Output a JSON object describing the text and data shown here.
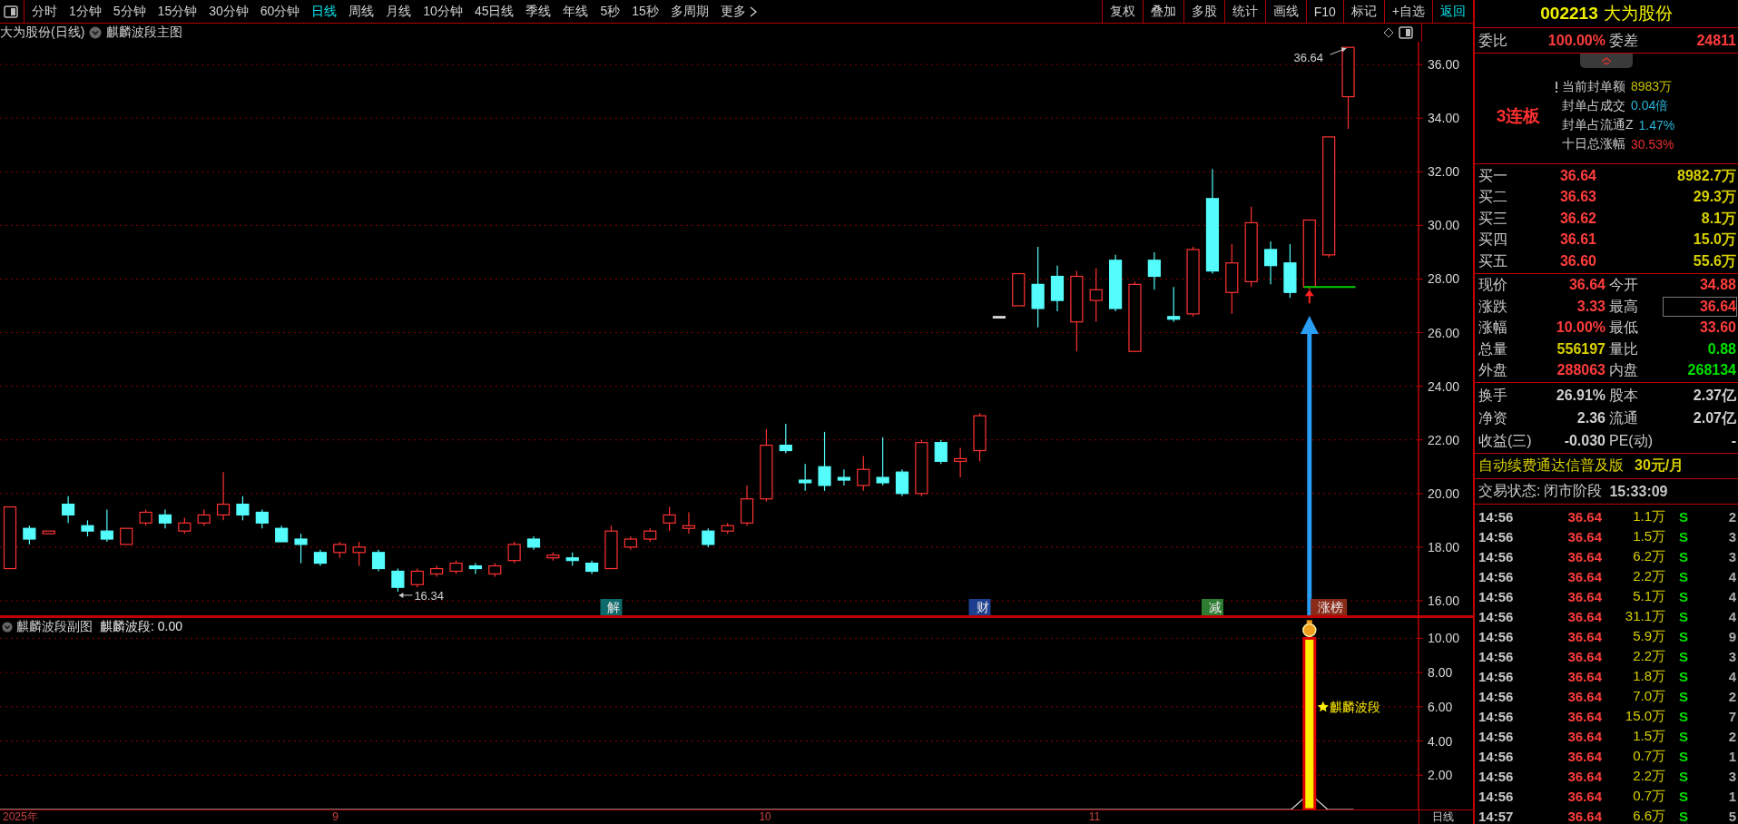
{
  "toolbar": {
    "periods": [
      {
        "label": "分时",
        "selected": false
      },
      {
        "label": "1分钟",
        "selected": false
      },
      {
        "label": "5分钟",
        "selected": false
      },
      {
        "label": "15分钟",
        "selected": false
      },
      {
        "label": "30分钟",
        "selected": false
      },
      {
        "label": "60分钟",
        "selected": false
      },
      {
        "label": "日线",
        "selected": true
      },
      {
        "label": "周线",
        "selected": false
      },
      {
        "label": "月线",
        "selected": false
      },
      {
        "label": "10分钟",
        "selected": false
      },
      {
        "label": "45日线",
        "selected": false
      },
      {
        "label": "季线",
        "selected": false
      },
      {
        "label": "年线",
        "selected": false
      },
      {
        "label": "5秒",
        "selected": false
      },
      {
        "label": "15秒",
        "selected": false
      },
      {
        "label": "多周期",
        "selected": false
      }
    ],
    "more": "更多",
    "buttons": [
      {
        "label": "复权",
        "active": false
      },
      {
        "label": "叠加",
        "active": false
      },
      {
        "label": "多股",
        "active": false
      },
      {
        "label": "统计",
        "active": false
      },
      {
        "label": "画线",
        "active": false
      },
      {
        "label": "F10",
        "active": false
      },
      {
        "label": "标记",
        "active": false
      },
      {
        "label": "+自选",
        "active": false
      },
      {
        "label": "返回",
        "active": true
      }
    ]
  },
  "main_chart": {
    "title": "大为股份(日线)",
    "indicator": "麒麟波段主图",
    "events": [
      {
        "label": "解",
        "color": "#0e6b6b"
      },
      {
        "label": "财",
        "color": "#1d3f8f"
      },
      {
        "label": "减",
        "color": "#2e7d32"
      },
      {
        "label": "涨榜",
        "color": "#8a2a18"
      }
    ],
    "chart_data": {
      "type": "candlestick",
      "grid": true,
      "ylim": [
        15.39,
        36.85
      ],
      "yticks": [
        {
          "value": 16,
          "label": "16.00"
        },
        {
          "value": 18,
          "label": "18.00"
        },
        {
          "value": 20,
          "label": "20.00"
        },
        {
          "value": 22,
          "label": "22.00"
        },
        {
          "value": 24,
          "label": "24.00"
        },
        {
          "value": 26,
          "label": "26.00"
        },
        {
          "value": 28,
          "label": "28.00"
        },
        {
          "value": 30,
          "label": "30.00"
        },
        {
          "value": 32,
          "label": "32.00"
        },
        {
          "value": 34,
          "label": "34.00"
        },
        {
          "value": 36,
          "label": "36.00"
        }
      ],
      "categories": [
        null,
        null,
        null,
        null,
        null,
        null,
        null,
        null,
        null,
        null,
        null,
        null,
        null,
        null,
        null,
        null,
        null,
        null,
        null,
        null,
        null,
        null,
        null,
        null,
        null,
        null,
        null,
        null,
        null,
        null,
        null,
        null,
        null,
        null,
        null,
        null,
        null,
        null,
        null,
        null,
        null,
        null,
        null,
        null,
        null,
        null,
        null,
        null,
        null,
        null,
        null,
        null,
        null,
        null,
        null,
        null,
        null,
        null,
        null,
        null,
        null,
        null,
        null,
        null,
        null,
        null,
        null,
        null,
        null,
        null
      ],
      "ohlc": [
        [
          17.2,
          19.5,
          17.2,
          19.5
        ],
        [
          18.7,
          18.8,
          18.1,
          18.3
        ],
        [
          18.5,
          18.6,
          18.5,
          18.6
        ],
        [
          19.6,
          19.9,
          18.9,
          19.2
        ],
        [
          18.8,
          19.0,
          18.4,
          18.6
        ],
        [
          18.6,
          19.4,
          18.2,
          18.3
        ],
        [
          18.1,
          18.7,
          18.1,
          18.7
        ],
        [
          18.9,
          19.4,
          18.8,
          19.3
        ],
        [
          19.2,
          19.4,
          18.7,
          18.9
        ],
        [
          18.6,
          19.1,
          18.5,
          18.9
        ],
        [
          18.9,
          19.4,
          18.8,
          19.2
        ],
        [
          19.2,
          20.8,
          19.0,
          19.6
        ],
        [
          19.6,
          19.9,
          19.0,
          19.2
        ],
        [
          19.3,
          19.4,
          18.7,
          18.9
        ],
        [
          18.7,
          18.8,
          18.2,
          18.2
        ],
        [
          18.3,
          18.5,
          17.4,
          18.1
        ],
        [
          17.8,
          17.9,
          17.3,
          17.4
        ],
        [
          17.8,
          18.2,
          17.6,
          18.1
        ],
        [
          17.8,
          18.2,
          17.3,
          18.0
        ],
        [
          17.8,
          17.9,
          17.1,
          17.2
        ],
        [
          17.1,
          17.2,
          16.34,
          16.5
        ],
        [
          16.6,
          17.2,
          16.5,
          17.1
        ],
        [
          17.0,
          17.3,
          16.9,
          17.2
        ],
        [
          17.1,
          17.5,
          17.0,
          17.4
        ],
        [
          17.3,
          17.4,
          17.0,
          17.2
        ],
        [
          17.0,
          17.4,
          16.9,
          17.3
        ],
        [
          17.5,
          18.2,
          17.4,
          18.1
        ],
        [
          18.3,
          18.4,
          17.9,
          18.0
        ],
        [
          17.6,
          17.8,
          17.5,
          17.7
        ],
        [
          17.6,
          17.8,
          17.3,
          17.5
        ],
        [
          17.4,
          17.5,
          17.0,
          17.1
        ],
        [
          17.2,
          18.8,
          17.2,
          18.6
        ],
        [
          18.0,
          18.4,
          17.9,
          18.3
        ],
        [
          18.3,
          18.7,
          18.2,
          18.6
        ],
        [
          18.9,
          19.5,
          18.6,
          19.2
        ],
        [
          18.7,
          19.3,
          18.5,
          18.8
        ],
        [
          18.6,
          18.7,
          18.0,
          18.1
        ],
        [
          18.6,
          18.9,
          18.5,
          18.8
        ],
        [
          18.9,
          20.3,
          18.8,
          19.8
        ],
        [
          19.8,
          22.4,
          19.7,
          21.8
        ],
        [
          21.8,
          22.6,
          21.5,
          21.6
        ],
        [
          20.5,
          21.1,
          20.1,
          20.4
        ],
        [
          21.0,
          22.3,
          20.1,
          20.3
        ],
        [
          20.6,
          20.9,
          20.3,
          20.5
        ],
        [
          20.3,
          21.4,
          20.1,
          20.9
        ],
        [
          20.6,
          22.1,
          20.3,
          20.4
        ],
        [
          20.8,
          20.9,
          19.9,
          20.0
        ],
        [
          20.0,
          22.0,
          19.9,
          21.9
        ],
        [
          21.9,
          22.0,
          21.1,
          21.2
        ],
        [
          21.2,
          21.7,
          20.6,
          21.3
        ],
        [
          21.6,
          23.0,
          21.2,
          22.9
        ],
        [
          26.6,
          26.6,
          26.6,
          26.6
        ],
        [
          27.0,
          28.2,
          27.0,
          28.2
        ],
        [
          27.8,
          29.2,
          26.2,
          26.9
        ],
        [
          28.1,
          28.5,
          26.8,
          27.2
        ],
        [
          26.4,
          28.3,
          25.3,
          28.1
        ],
        [
          27.2,
          28.4,
          26.4,
          27.6
        ],
        [
          28.7,
          28.9,
          26.8,
          26.9
        ],
        [
          25.3,
          27.9,
          25.3,
          27.8
        ],
        [
          28.7,
          29.0,
          27.6,
          28.1
        ],
        [
          26.6,
          27.7,
          26.4,
          26.5
        ],
        [
          26.7,
          29.2,
          26.6,
          29.1
        ],
        [
          31.0,
          32.1,
          28.2,
          28.3
        ],
        [
          27.5,
          29.3,
          26.7,
          28.6
        ],
        [
          27.9,
          30.7,
          27.7,
          30.1
        ],
        [
          29.1,
          29.4,
          27.8,
          28.5
        ],
        [
          28.6,
          29.3,
          27.3,
          27.5
        ],
        [
          27.7,
          30.2,
          27.6,
          30.2
        ],
        [
          28.9,
          33.3,
          28.8,
          33.3
        ],
        [
          34.8,
          36.64,
          33.6,
          36.64
        ]
      ],
      "annotations": [
        "36.64",
        "16.34"
      ]
    }
  },
  "sub_chart": {
    "title": "麒麟波段副图",
    "reading": "麒麟波段: 0.00",
    "axis_mode": "日线",
    "chart_data": {
      "type": "bar",
      "grid": true,
      "ylim": [
        0,
        11.24
      ],
      "yticks": [
        {
          "value": 2,
          "label": "2.00"
        },
        {
          "value": 4,
          "label": "4.00"
        },
        {
          "value": 6,
          "label": "6.00"
        },
        {
          "value": 8,
          "label": "8.00"
        },
        {
          "value": 10,
          "label": "10.00"
        }
      ],
      "categories": [
        "2025年",
        null,
        null,
        null,
        null,
        null,
        null,
        null,
        null,
        null,
        null,
        null,
        null,
        null,
        null,
        null,
        null,
        "9",
        null,
        null,
        null,
        null,
        null,
        null,
        null,
        null,
        null,
        null,
        null,
        null,
        null,
        null,
        null,
        null,
        null,
        null,
        null,
        null,
        null,
        "10",
        null,
        null,
        null,
        null,
        null,
        null,
        null,
        null,
        null,
        null,
        null,
        null,
        null,
        null,
        null,
        null,
        "11",
        null,
        null,
        null,
        null,
        null,
        null,
        null,
        null,
        null,
        null,
        null,
        null,
        null
      ],
      "series": [
        {
          "name": "麒麟波段",
          "values": [
            null,
            null,
            null,
            null,
            null,
            null,
            null,
            null,
            null,
            null,
            null,
            null,
            null,
            null,
            null,
            null,
            null,
            null,
            null,
            null,
            null,
            null,
            null,
            null,
            null,
            null,
            null,
            null,
            null,
            null,
            null,
            null,
            null,
            null,
            null,
            null,
            null,
            null,
            null,
            null,
            null,
            null,
            null,
            null,
            null,
            null,
            null,
            null,
            null,
            null,
            null,
            null,
            null,
            null,
            null,
            null,
            null,
            null,
            null,
            null,
            null,
            null,
            null,
            null,
            null,
            null,
            null,
            10,
            null,
            null
          ]
        }
      ]
    }
  },
  "quote": {
    "code": "002213",
    "name": "大为股份",
    "ratio": {
      "label": "委比",
      "value": "100.00%",
      "label2": "委差",
      "value2": "24811"
    },
    "streak": "3连板",
    "seal_info": [
      {
        "label": "当前封单额",
        "value": "8983万",
        "color": "#c8c000"
      },
      {
        "label": "封单占成交",
        "value": "0.04倍",
        "color": "#2ab4d8"
      },
      {
        "label": "封单占流通Z",
        "value": "1.47%",
        "color": "#2ab4d8"
      },
      {
        "label": "十日总涨幅",
        "value": "30.53%",
        "color": "#e83030"
      }
    ],
    "bids": [
      {
        "label": "买一",
        "price": "36.64",
        "volume": "8982.7万"
      },
      {
        "label": "买二",
        "price": "36.63",
        "volume": "29.3万"
      },
      {
        "label": "买三",
        "price": "36.62",
        "volume": "8.1万"
      },
      {
        "label": "买四",
        "price": "36.61",
        "volume": "15.0万"
      },
      {
        "label": "买五",
        "price": "36.60",
        "volume": "55.6万"
      }
    ],
    "stats": [
      {
        "left": {
          "label": "现价",
          "value": "36.64",
          "color": "#ff3c3c",
          "boxed": false
        },
        "right": {
          "label": "今开",
          "value": "34.88",
          "color": "#ff3c3c",
          "boxed": false
        }
      },
      {
        "left": {
          "label": "涨跌",
          "value": "3.33",
          "color": "#ff3c3c",
          "boxed": false
        },
        "right": {
          "label": "最高",
          "value": "36.64",
          "color": "#ff3c3c",
          "boxed": true
        }
      },
      {
        "left": {
          "label": "涨幅",
          "value": "10.00%",
          "color": "#ff3c3c",
          "boxed": false
        },
        "right": {
          "label": "最低",
          "value": "33.60",
          "color": "#ff3c3c",
          "boxed": false
        }
      },
      {
        "left": {
          "label": "总量",
          "value": "556197",
          "color": "#d8d000",
          "boxed": false
        },
        "right": {
          "label": "量比",
          "value": "0.88",
          "color": "#00e000",
          "boxed": false
        }
      },
      {
        "left": {
          "label": "外盘",
          "value": "288063",
          "color": "#ff3c3c",
          "boxed": false
        },
        "right": {
          "label": "内盘",
          "value": "268134",
          "color": "#00e000",
          "boxed": false
        }
      }
    ],
    "fundamentals": [
      {
        "left": {
          "label": "换手",
          "value": "26.91%"
        },
        "right": {
          "label": "股本",
          "value": "2.37亿"
        }
      },
      {
        "left": {
          "label": "净资",
          "value": "2.36"
        },
        "right": {
          "label": "流通",
          "value": "2.07亿"
        }
      },
      {
        "left": {
          "label": "收益(三)",
          "value": "-0.030"
        },
        "right": {
          "label": "PE(动)",
          "value": "-"
        }
      }
    ],
    "ad": {
      "text": "自动续费通达信普及版",
      "price": "30元/月"
    },
    "status": {
      "label": "交易状态:",
      "phase": "闭市阶段",
      "time": "15:33:09"
    },
    "ticks": [
      {
        "time": "14:56",
        "price": "36.64",
        "volume": "1.1万",
        "side": "S",
        "count": "2"
      },
      {
        "time": "14:56",
        "price": "36.64",
        "volume": "1.5万",
        "side": "S",
        "count": "3"
      },
      {
        "time": "14:56",
        "price": "36.64",
        "volume": "6.2万",
        "side": "S",
        "count": "3"
      },
      {
        "time": "14:56",
        "price": "36.64",
        "volume": "2.2万",
        "side": "S",
        "count": "4"
      },
      {
        "time": "14:56",
        "price": "36.64",
        "volume": "5.1万",
        "side": "S",
        "count": "4"
      },
      {
        "time": "14:56",
        "price": "36.64",
        "volume": "31.1万",
        "side": "S",
        "count": "4"
      },
      {
        "time": "14:56",
        "price": "36.64",
        "volume": "5.9万",
        "side": "S",
        "count": "9"
      },
      {
        "time": "14:56",
        "price": "36.64",
        "volume": "2.2万",
        "side": "S",
        "count": "3"
      },
      {
        "time": "14:56",
        "price": "36.64",
        "volume": "1.8万",
        "side": "S",
        "count": "4"
      },
      {
        "time": "14:56",
        "price": "36.64",
        "volume": "7.0万",
        "side": "S",
        "count": "2"
      },
      {
        "time": "14:56",
        "price": "36.64",
        "volume": "15.0万",
        "side": "S",
        "count": "7"
      },
      {
        "time": "14:56",
        "price": "36.64",
        "volume": "1.5万",
        "side": "S",
        "count": "2"
      },
      {
        "time": "14:56",
        "price": "36.64",
        "volume": "0.7万",
        "side": "S",
        "count": "1"
      },
      {
        "time": "14:56",
        "price": "36.64",
        "volume": "2.2万",
        "side": "S",
        "count": "3"
      },
      {
        "time": "14:56",
        "price": "36.64",
        "volume": "0.7万",
        "side": "S",
        "count": "1"
      },
      {
        "time": "14:57",
        "price": "36.64",
        "volume": "6.6万",
        "side": "S",
        "count": "5"
      }
    ]
  }
}
